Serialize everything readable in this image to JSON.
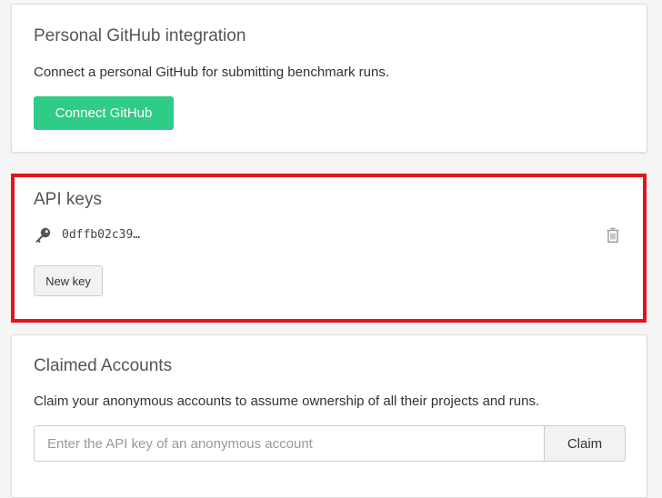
{
  "github": {
    "title": "Personal GitHub integration",
    "description": "Connect a personal GitHub for submitting benchmark runs.",
    "connect_label": "Connect GitHub"
  },
  "api_keys": {
    "title": "API keys",
    "keys": [
      {
        "value": "0dffb02c39…",
        "icon": "key-icon",
        "delete_icon": "trash-icon"
      }
    ],
    "new_key_label": "New key"
  },
  "claimed": {
    "title": "Claimed Accounts",
    "description": "Claim your anonymous accounts to assume ownership of all their projects and runs.",
    "input_placeholder": "Enter the API key of an anonymous account",
    "input_value": "",
    "claim_label": "Claim"
  },
  "colors": {
    "accent": "#2ecc86",
    "highlight": "#e4141e"
  }
}
